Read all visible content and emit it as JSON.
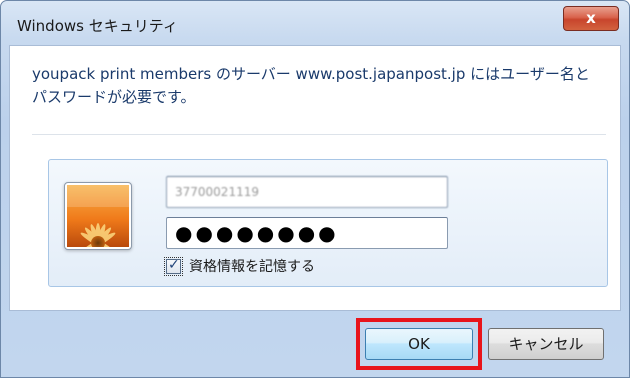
{
  "window": {
    "title": "Windows セキュリティ",
    "close_label": "x"
  },
  "dialog": {
    "message": "youpack print members のサーバー www.post.japanpost.jp にはユーザー名とパスワードが必要です。",
    "username_value": "37700021119",
    "password_value": "●●●●●●●●",
    "remember_checked": true,
    "remember_label": "資格情報を記憶する",
    "avatar_icon": "flower-user-tile-icon"
  },
  "buttons": {
    "ok_label": "OK",
    "cancel_label": "キャンセル"
  },
  "colors": {
    "highlight": "#e8141b",
    "message_text": "#1a3a6b",
    "ok_button": "#bee6fd"
  }
}
